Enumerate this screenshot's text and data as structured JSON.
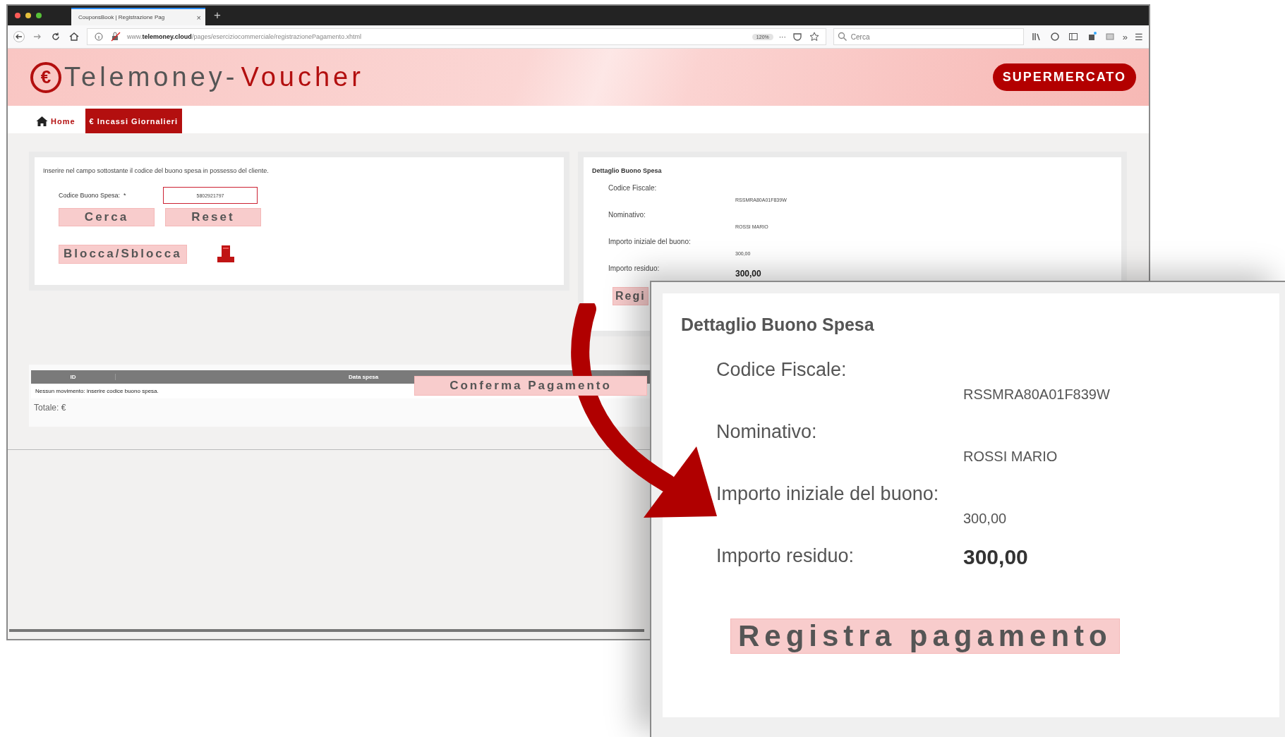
{
  "browser": {
    "tab": {
      "title": "CouponsBook | Registrazione Pag",
      "close": "×"
    },
    "new_tab": "+",
    "url": "www.**telemoney.cloud**/pages/eserciziocommerciale/registrazionePagamento.xhtml",
    "zoom": "120%",
    "more": "···",
    "search": {
      "placeholder": "Cerca"
    },
    "overflow": "»",
    "menu": "☰"
  },
  "header": {
    "logo": {
      "symbol": "€",
      "brand": "Telemoney-",
      "product": "Voucher"
    },
    "badge": "SUPERMERCATO"
  },
  "nav": [
    {
      "label": "Home",
      "kind": "home",
      "selected": false
    },
    {
      "label": "€ Incassi Giornalieri",
      "kind": "plain",
      "selected": true
    }
  ],
  "search_panel": {
    "instruction": "Inserire nel campo sottostante il codice del buono spesa in possesso del cliente.",
    "field": {
      "label": "Codice Buono Spesa:",
      "required": "*",
      "value": "5802921797"
    },
    "buttons": [
      "Cerca",
      "Reset"
    ],
    "lock_button": "Blocca/Sblocca"
  },
  "detail_panel": {
    "title": "Dettaglio Buono Spesa",
    "rows": [
      {
        "label": "Codice Fiscale:",
        "value": "RSSMRA80A01F839W",
        "emphasis": false
      },
      {
        "label": "Nominativo:",
        "value": "ROSSI MARIO",
        "emphasis": false
      },
      {
        "label": "Importo iniziale del buono:",
        "value": "300,00",
        "emphasis": false
      },
      {
        "label": "Importo residuo:",
        "value": "300,00",
        "emphasis": true
      }
    ],
    "button": "Regi"
  },
  "movements_table": {
    "columns": [
      "ID",
      "Data spesa"
    ],
    "empty_message": "Nessun movimento: inserire codice buono spesa.",
    "total": "Totale: €"
  },
  "confirm_button": "Conferma Pagamento",
  "callout": {
    "title": "Dettaglio Buono Spesa",
    "rows": [
      {
        "label": "Codice Fiscale:",
        "value": "RSSMRA80A01F839W",
        "emphasis": false
      },
      {
        "label": "Nominativo:",
        "value": "ROSSI MARIO",
        "emphasis": false
      },
      {
        "label": "Importo iniziale del buono:",
        "value": "300,00",
        "emphasis": false
      },
      {
        "label": "Importo residuo:",
        "value": "300,00",
        "emphasis": true
      }
    ],
    "button": "Registra pagamento"
  }
}
